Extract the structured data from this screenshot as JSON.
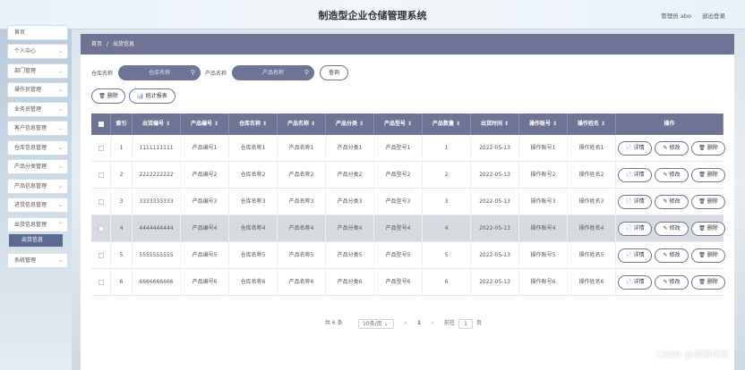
{
  "header": {
    "title": "制造型企业仓储管理系统",
    "user": "管理员 abo",
    "logout": "退出登录"
  },
  "sidebar": {
    "items": [
      {
        "label": "首页"
      },
      {
        "label": "个人中心"
      },
      {
        "label": "部门管理"
      },
      {
        "label": "操作员管理"
      },
      {
        "label": "业务员管理"
      },
      {
        "label": "客户信息管理"
      },
      {
        "label": "仓库信息管理"
      },
      {
        "label": "产品分类管理"
      },
      {
        "label": "产品信息管理"
      },
      {
        "label": "进货信息管理"
      },
      {
        "label": "出货信息管理"
      },
      {
        "label": "系统管理"
      }
    ],
    "active_sub": "出货信息"
  },
  "breadcrumb": {
    "home": "首页",
    "separator": "/",
    "current": "出货信息"
  },
  "search": {
    "warehouse_label": "仓库名称",
    "warehouse_placeholder": "仓库名称",
    "product_label": "产品名称",
    "product_placeholder": "产品名称",
    "query_button": "查询"
  },
  "actions": {
    "delete": "删除",
    "stats_report": "统计报表"
  },
  "table": {
    "columns": [
      "索引",
      "出货编号",
      "产品编号",
      "仓库名称",
      "产品名称",
      "产品分类",
      "产品型号",
      "产品数量",
      "出货时间",
      "操作账号",
      "操作姓名",
      "操作"
    ],
    "rows": [
      {
        "index": "1",
        "ship_no": "1111111111",
        "product_no": "产品编号1",
        "warehouse": "仓库名称1",
        "product_name": "产品名称1",
        "category": "产品分类1",
        "model": "产品型号1",
        "quantity": "1",
        "time": "2022-05-13",
        "account": "操作账号1",
        "operator": "操作姓名1"
      },
      {
        "index": "2",
        "ship_no": "2222222222",
        "product_no": "产品编号2",
        "warehouse": "仓库名称2",
        "product_name": "产品名称2",
        "category": "产品分类2",
        "model": "产品型号2",
        "quantity": "2",
        "time": "2022-05-13",
        "account": "操作账号2",
        "operator": "操作姓名2"
      },
      {
        "index": "3",
        "ship_no": "3333333333",
        "product_no": "产品编号3",
        "warehouse": "仓库名称3",
        "product_name": "产品名称3",
        "category": "产品分类3",
        "model": "产品型号3",
        "quantity": "3",
        "time": "2022-05-13",
        "account": "操作账号3",
        "operator": "操作姓名3"
      },
      {
        "index": "4",
        "ship_no": "4444444444",
        "product_no": "产品编号4",
        "warehouse": "仓库名称4",
        "product_name": "产品名称4",
        "category": "产品分类4",
        "model": "产品型号4",
        "quantity": "4",
        "time": "2022-05-13",
        "account": "操作账号4",
        "operator": "操作姓名4"
      },
      {
        "index": "5",
        "ship_no": "5555555555",
        "product_no": "产品编号5",
        "warehouse": "仓库名称5",
        "product_name": "产品名称5",
        "category": "产品分类5",
        "model": "产品型号5",
        "quantity": "5",
        "time": "2022-05-13",
        "account": "操作账号5",
        "operator": "操作姓名5"
      },
      {
        "index": "6",
        "ship_no": "6666666666",
        "product_no": "产品编号6",
        "warehouse": "仓库名称6",
        "product_name": "产品名称6",
        "category": "产品分类6",
        "model": "产品型号6",
        "quantity": "6",
        "time": "2022-05-13",
        "account": "操作账号6",
        "operator": "操作姓名6"
      }
    ],
    "row_actions": {
      "detail": "详情",
      "edit": "修改",
      "delete": "删除"
    }
  },
  "pager": {
    "total": "共 6 条",
    "page_size": "10条/页",
    "prev": "‹",
    "current_page": "1",
    "next": "›",
    "goto_label": "前往",
    "goto_value": "1",
    "page_unit": "页"
  },
  "watermark": "CSDN @邻居科技"
}
